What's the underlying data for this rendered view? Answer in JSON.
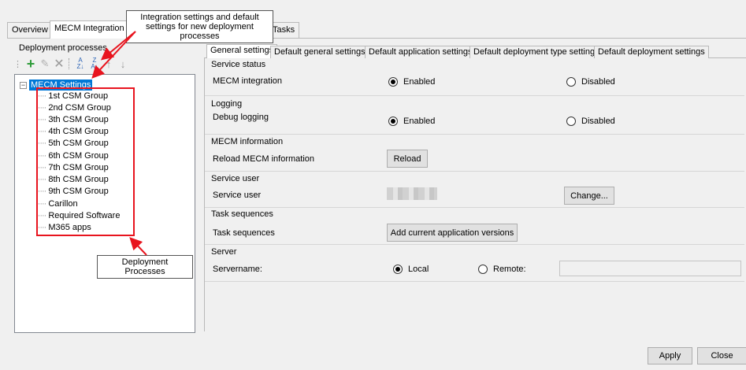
{
  "outer_tabs": [
    {
      "label": "Overview"
    },
    {
      "label": "MECM Integration"
    },
    {
      "label": "Tasks"
    }
  ],
  "callouts": {
    "integration": "Integration settings and default settings for new deployment processes",
    "deployment": "Deployment Processes"
  },
  "left_panel": {
    "group_label": "Deployment processes",
    "toolbar": [
      {
        "icon": "add-icon"
      },
      {
        "icon": "edit-icon"
      },
      {
        "icon": "delete-icon"
      },
      {
        "icon": "sort-az-icon"
      },
      {
        "icon": "sort-za-icon"
      },
      {
        "icon": "move-up-icon"
      },
      {
        "icon": "move-down-icon"
      }
    ],
    "root": "MECM Settings",
    "items": [
      "1st CSM Group",
      "2nd CSM Group",
      "3th CSM Group",
      "4th CSM Group",
      "5th CSM Group",
      "6th CSM Group",
      "7th CSM Group",
      "8th CSM Group",
      "9th CSM Group",
      "Carillon",
      "Required Software",
      "M365 apps"
    ]
  },
  "inner_tabs": [
    {
      "label": "General settings"
    },
    {
      "label": "Default general settings"
    },
    {
      "label": "Default application settings"
    },
    {
      "label": "Default deployment type settings"
    },
    {
      "label": "Default deployment settings"
    }
  ],
  "sections": {
    "service_status": {
      "title": "Service status",
      "label": "MECM integration",
      "opt1": "Enabled",
      "opt2": "Disabled"
    },
    "logging": {
      "title": "Logging",
      "label": "Debug logging",
      "opt1": "Enabled",
      "opt2": "Disabled"
    },
    "mecm_info": {
      "title": "MECM information",
      "label": "Reload MECM information",
      "button": "Reload"
    },
    "service_user": {
      "title": "Service user",
      "label": "Service user",
      "button": "Change..."
    },
    "task_sequences": {
      "title": "Task sequences",
      "label": "Task sequences",
      "button": "Add current application versions"
    },
    "server": {
      "title": "Server",
      "label": "Servername:",
      "opt1": "Local",
      "opt2": "Remote:"
    }
  },
  "footer": {
    "apply": "Apply",
    "close": "Close"
  }
}
